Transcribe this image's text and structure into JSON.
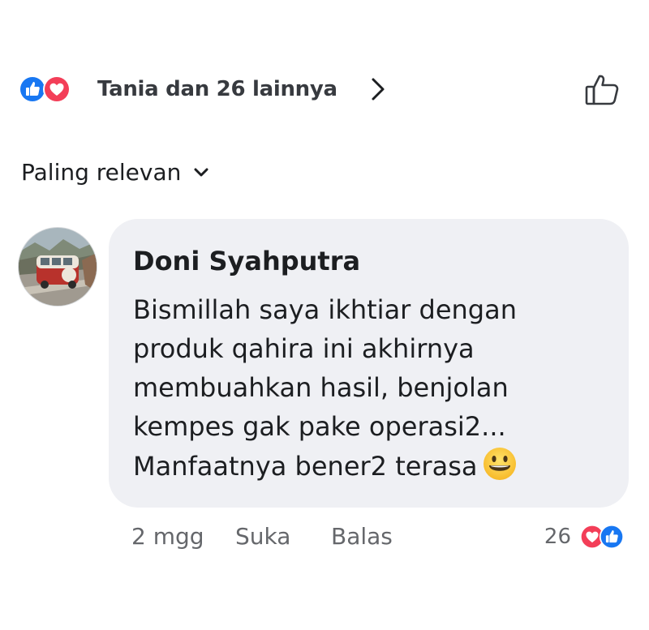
{
  "reactions_summary": {
    "text": "Tania dan 26 lainnya",
    "icons": [
      "like-reaction-icon",
      "love-reaction-icon"
    ]
  },
  "sort": {
    "label": "Paling relevan"
  },
  "comment": {
    "author": "Doni Syahputra",
    "text_lines": [
      "Bismillah saya ikhtiar dengan",
      "produk qahira ini akhirnya",
      "membuahkan hasil, benjolan",
      "kempes gak pake operasi2...",
      "Manfaatnya bener2 terasa"
    ],
    "emoji": "grinning-face",
    "timestamp": "2 mgg",
    "like_label": "Suka",
    "reply_label": "Balas",
    "reaction_count": "26"
  },
  "colors": {
    "like_blue": "#1877f2",
    "love_red": "#f33e58",
    "bubble_bg": "#eff0f4",
    "secondary_text": "#65676b"
  }
}
